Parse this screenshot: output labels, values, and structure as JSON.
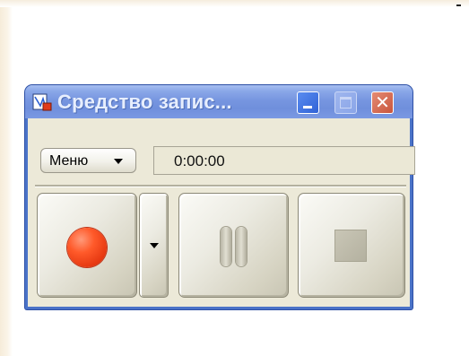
{
  "window": {
    "title": "Средство запис...",
    "close_glyph": "✕"
  },
  "toolbar": {
    "menu_label": "Меню",
    "time_display": "0:00:00"
  },
  "icons": {
    "app": "recorder-app-icon",
    "minimize": "minimize-icon",
    "maximize": "maximize-icon",
    "close": "close-icon",
    "menu_dropdown": "chevron-down-icon",
    "record": "record-icon",
    "record_options": "chevron-down-icon",
    "pause": "pause-icon",
    "stop": "stop-icon"
  },
  "colors": {
    "titlebar": "#7796e0",
    "window_border": "#4a73c8",
    "window_body": "#ece9d8",
    "record": "#ff4a1a",
    "close_button": "#d66a50",
    "minimize_button": "#2f62d6"
  }
}
